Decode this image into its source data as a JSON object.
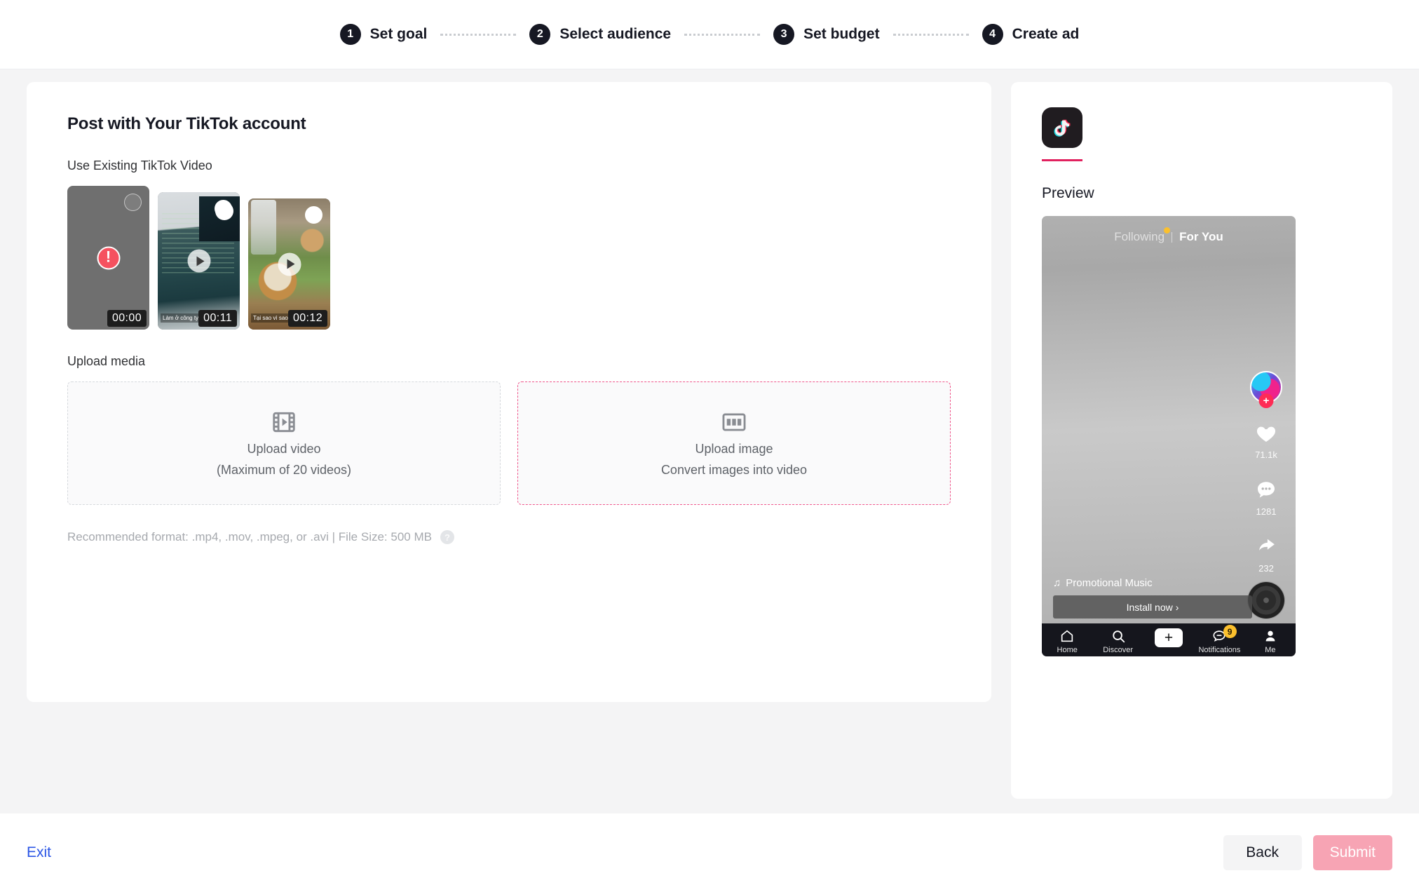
{
  "stepper": {
    "steps": [
      {
        "num": "1",
        "label": "Set goal"
      },
      {
        "num": "2",
        "label": "Select audience"
      },
      {
        "num": "3",
        "label": "Set budget"
      },
      {
        "num": "4",
        "label": "Create ad"
      }
    ]
  },
  "main": {
    "title": "Post with Your TikTok account",
    "existing_video_label": "Use Existing TikTok Video",
    "videos": [
      {
        "duration": "00:00",
        "state": "error",
        "error_glyph": "!",
        "caption": ""
      },
      {
        "duration": "00:11",
        "state": "ready",
        "caption": "Làm ở công ty công nghệ"
      },
      {
        "duration": "00:12",
        "state": "ready",
        "caption": "Tại sao vì sao 😂😂😂"
      }
    ],
    "upload_label": "Upload media",
    "upload_video": {
      "icon": "film-strip-icon",
      "title": "Upload video",
      "subtitle": "(Maximum of 20 videos)"
    },
    "upload_image": {
      "icon": "image-strip-icon",
      "title": "Upload image",
      "subtitle": "Convert images into video"
    },
    "hint": "Recommended format: .mp4, .mov, .mpeg, or .avi | File Size: 500 MB",
    "help_glyph": "?"
  },
  "preview": {
    "logo_name": "tiktok-logo-icon",
    "title": "Preview",
    "feed": {
      "following_label": "Following",
      "for_you_label": "For You"
    },
    "actions": {
      "like_count": "71.1k",
      "comment_count": "1281",
      "share_count": "232"
    },
    "music_glyph": "♫",
    "music_label": "Promotional Music",
    "cta_label": "Install now",
    "cta_chevron": "›",
    "nav": [
      {
        "label": "Home",
        "icon": "home-icon",
        "badge": ""
      },
      {
        "label": "Discover",
        "icon": "search-icon",
        "badge": ""
      },
      {
        "label": "",
        "icon": "plus-icon",
        "badge": ""
      },
      {
        "label": "Notifications",
        "icon": "message-icon",
        "badge": "9"
      },
      {
        "label": "Me",
        "icon": "person-icon",
        "badge": ""
      }
    ]
  },
  "footer": {
    "exit_label": "Exit",
    "back_label": "Back",
    "submit_label": "Submit"
  },
  "colors": {
    "accent_pink": "#fe2c55",
    "tab_underline": "#e1215e",
    "link_blue": "#2a55e5",
    "submit_disabled": "#f7a4b4",
    "badge_yellow": "#fbc02d"
  }
}
